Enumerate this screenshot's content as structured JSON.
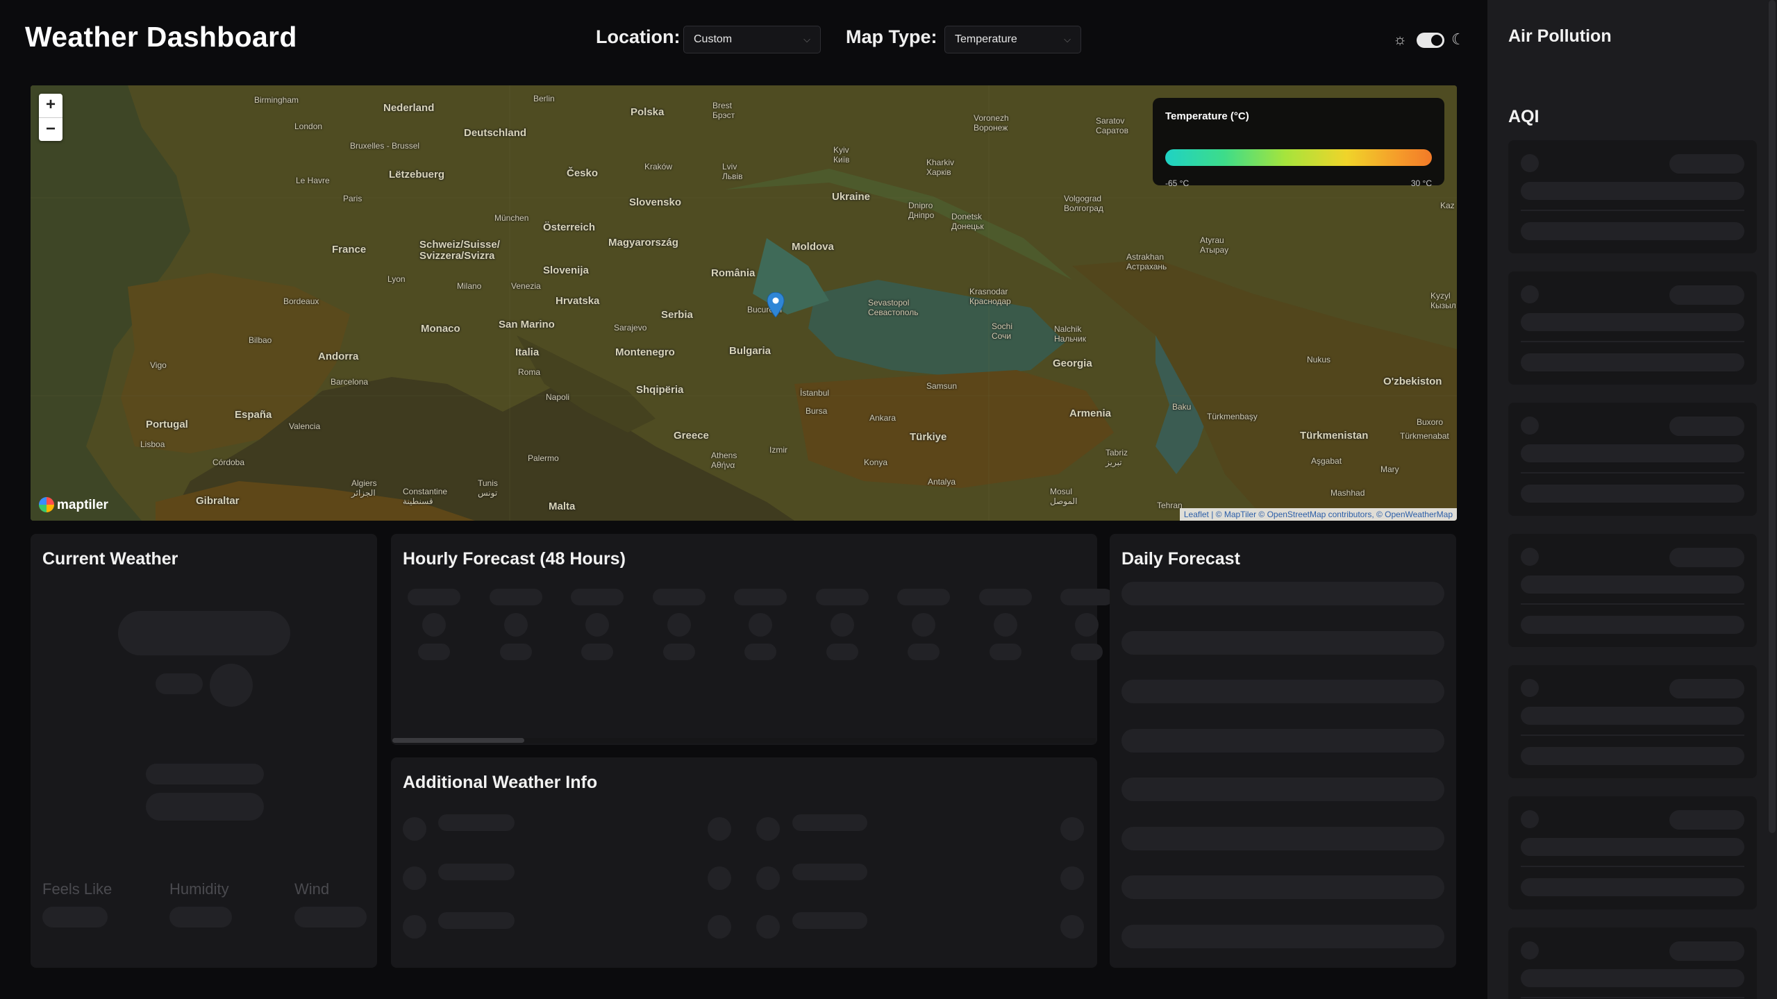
{
  "header": {
    "title": "Weather Dashboard",
    "location_label": "Location:",
    "location_value": "Custom",
    "map_type_label": "Map Type:",
    "map_type_value": "Temperature"
  },
  "map": {
    "legend_title": "Temperature (°C)",
    "legend_min": "-65 °C",
    "legend_max": "30 °C",
    "zoom_in": "+",
    "zoom_out": "−",
    "logo_text": "maptiler",
    "attribution": "Leaflet | © MapTiler © OpenStreetMap contributors, © OpenWeatherMap",
    "labels_major": [
      "Nederland",
      "Deutschland",
      "Polska",
      "Česko",
      "Slovensko",
      "Österreich",
      "Ukraine",
      "Lëtzebuerg",
      "France",
      "Schweiz/Suisse/ Svizzera/Svizra",
      "Magyarország",
      "Moldova",
      "România",
      "Slovenija",
      "Hrvatska",
      "Serbia",
      "Bulgaria",
      "Monaco",
      "San Marino",
      "Andorra",
      "Italia",
      "Montenegro",
      "Shqipëria",
      "Portugal",
      "España",
      "Greece",
      "Türkiye",
      "Georgia",
      "Armenia",
      "Türkmenistan",
      "O'zbekiston",
      "Malta",
      "Gibraltar"
    ],
    "labels_minor": [
      "Birmingham",
      "London",
      "Bruxelles - Brussel",
      "Le Havre",
      "Paris",
      "Berlin",
      "Brest Брэст",
      "Kraków",
      "Lviv Львів",
      "Kyiv Київ",
      "Kharkiv Харків",
      "Voronezh Воронеж",
      "Saratov Саратов",
      "Dnipro Дніпро",
      "Donetsk Донецьк",
      "Volgograd Волгоград",
      "München",
      "Bordeaux",
      "Lyon",
      "Milano",
      "Venezia",
      "Bilbao",
      "Barcelona",
      "Vigo",
      "Lisboa",
      "Valencia",
      "Córdoba",
      "Roma",
      "Napoli",
      "Sarajevo",
      "Bucureşti",
      "Sevastopol Севастополь",
      "Krasnodar Краснодар",
      "Sochi Сочи",
      "Nalchik Нальчик",
      "Astrakhan Астрахань",
      "Atyrau Атырау",
      "İstanbul",
      "Bursa",
      "Samsun",
      "Ankara",
      "Izmir",
      "Konya",
      "Antalya",
      "Athens Αθήνα",
      "Palermo",
      "Tunis تونس",
      "Algiers الجزائر",
      "Constantine قسنطينة",
      "Baku",
      "Tabriz تبریز",
      "Mosul الموصل",
      "Aşgabat",
      "Mashhad",
      "Mary",
      "Türkmenbaşy",
      "Nukus",
      "Buxoro",
      "Türkmenabat",
      "Tehran",
      "Kyzyl Кызыл",
      "Kaz"
    ]
  },
  "cards": {
    "current_weather": {
      "title": "Current Weather",
      "feels_like": "Feels Like",
      "humidity": "Humidity",
      "wind": "Wind"
    },
    "hourly": {
      "title": "Hourly Forecast (48 Hours)"
    },
    "additional": {
      "title": "Additional Weather Info"
    },
    "daily": {
      "title": "Daily Forecast"
    }
  },
  "air_pollution": {
    "title": "Air Pollution",
    "aqi_title": "AQI"
  },
  "colors": {
    "background": "#0b0b0d",
    "card": "#18181b",
    "skeleton": "#222226",
    "panel": "#1c1c1f"
  }
}
